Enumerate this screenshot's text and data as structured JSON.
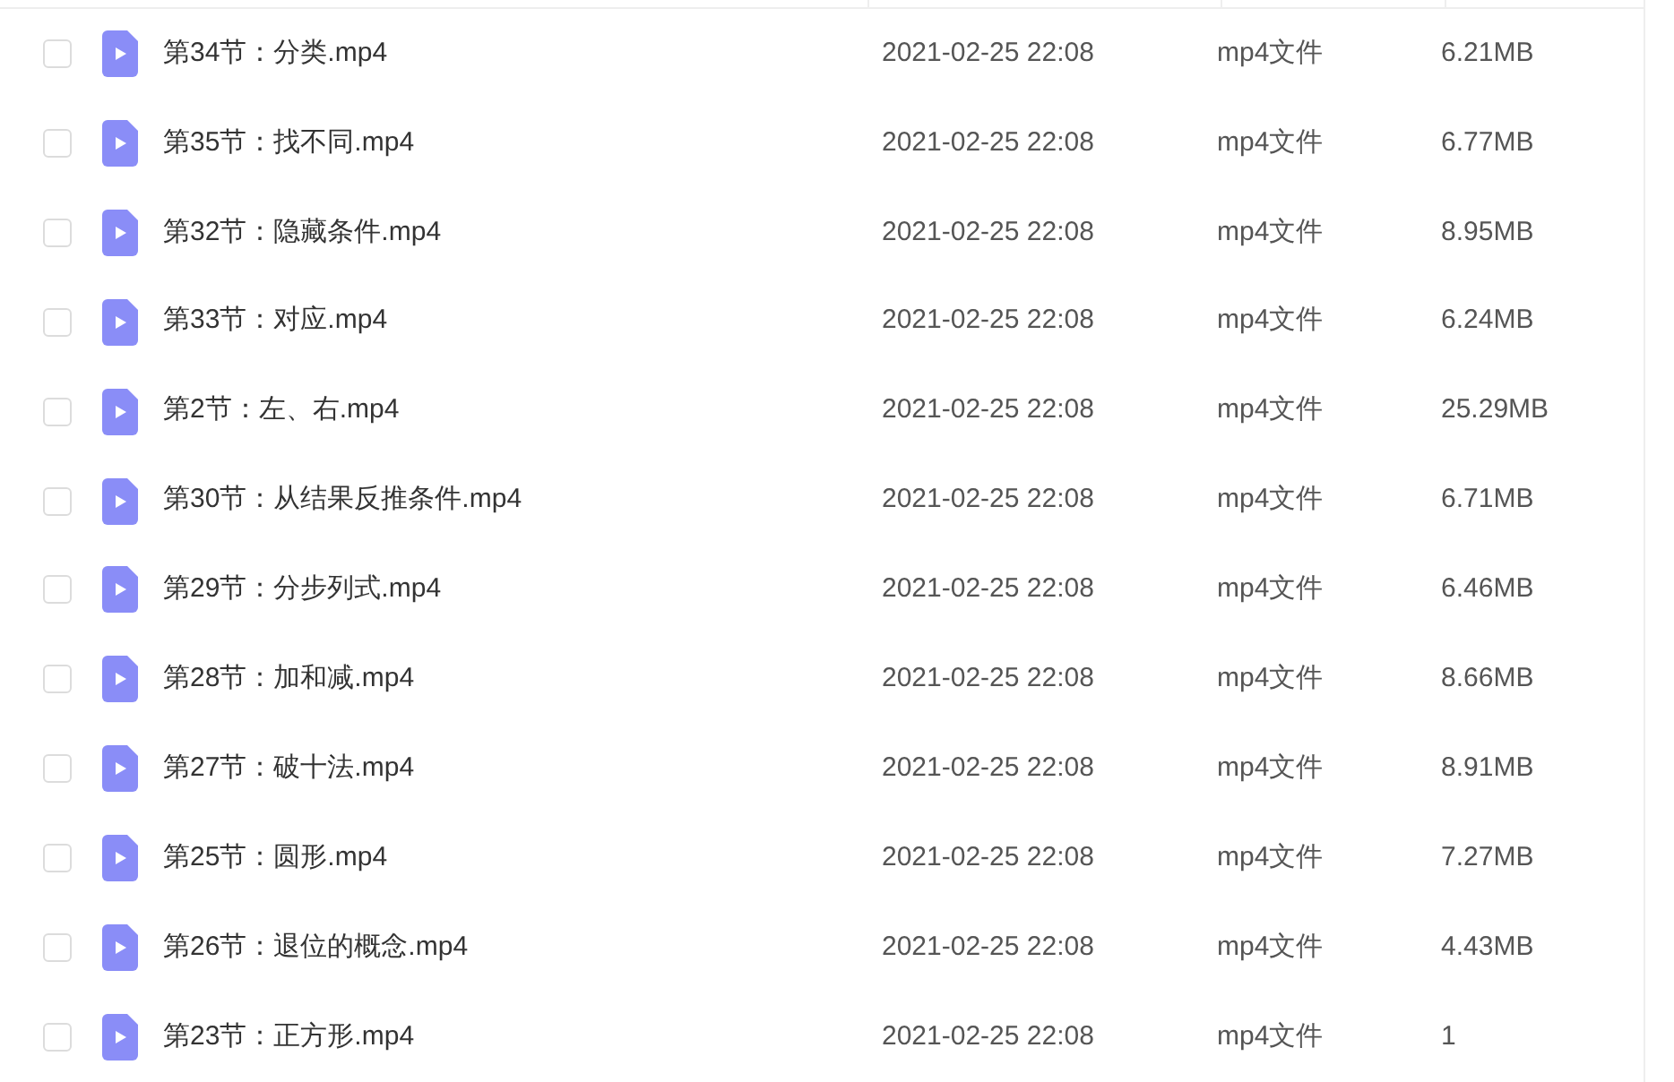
{
  "files": [
    {
      "name": "第34节：分类.mp4",
      "checked": false,
      "date": "2021-02-25 22:08",
      "type": "mp4文件",
      "size": "6.21MB"
    },
    {
      "name": "第35节：找不同.mp4",
      "checked": false,
      "date": "2021-02-25 22:08",
      "type": "mp4文件",
      "size": "6.77MB"
    },
    {
      "name": "第32节：隐藏条件.mp4",
      "checked": false,
      "date": "2021-02-25 22:08",
      "type": "mp4文件",
      "size": "8.95MB"
    },
    {
      "name": "第33节：对应.mp4",
      "checked": false,
      "date": "2021-02-25 22:08",
      "type": "mp4文件",
      "size": "6.24MB"
    },
    {
      "name": "第2节：左、右.mp4",
      "checked": false,
      "date": "2021-02-25 22:08",
      "type": "mp4文件",
      "size": "25.29MB"
    },
    {
      "name": "第30节：从结果反推条件.mp4",
      "checked": false,
      "date": "2021-02-25 22:08",
      "type": "mp4文件",
      "size": "6.71MB"
    },
    {
      "name": "第29节：分步列式.mp4",
      "checked": false,
      "date": "2021-02-25 22:08",
      "type": "mp4文件",
      "size": "6.46MB"
    },
    {
      "name": "第28节：加和减.mp4",
      "checked": false,
      "date": "2021-02-25 22:08",
      "type": "mp4文件",
      "size": "8.66MB"
    },
    {
      "name": "第27节：破十法.mp4",
      "checked": false,
      "date": "2021-02-25 22:08",
      "type": "mp4文件",
      "size": "8.91MB"
    },
    {
      "name": "第25节：圆形.mp4",
      "checked": false,
      "date": "2021-02-25 22:08",
      "type": "mp4文件",
      "size": "7.27MB"
    },
    {
      "name": "第26节：退位的概念.mp4",
      "checked": false,
      "date": "2021-02-25 22:08",
      "type": "mp4文件",
      "size": "4.43MB"
    },
    {
      "name": "第23节：正方形.mp4",
      "checked": false,
      "date": "2021-02-25 22:08",
      "type": "mp4文件",
      "size": "1"
    }
  ]
}
